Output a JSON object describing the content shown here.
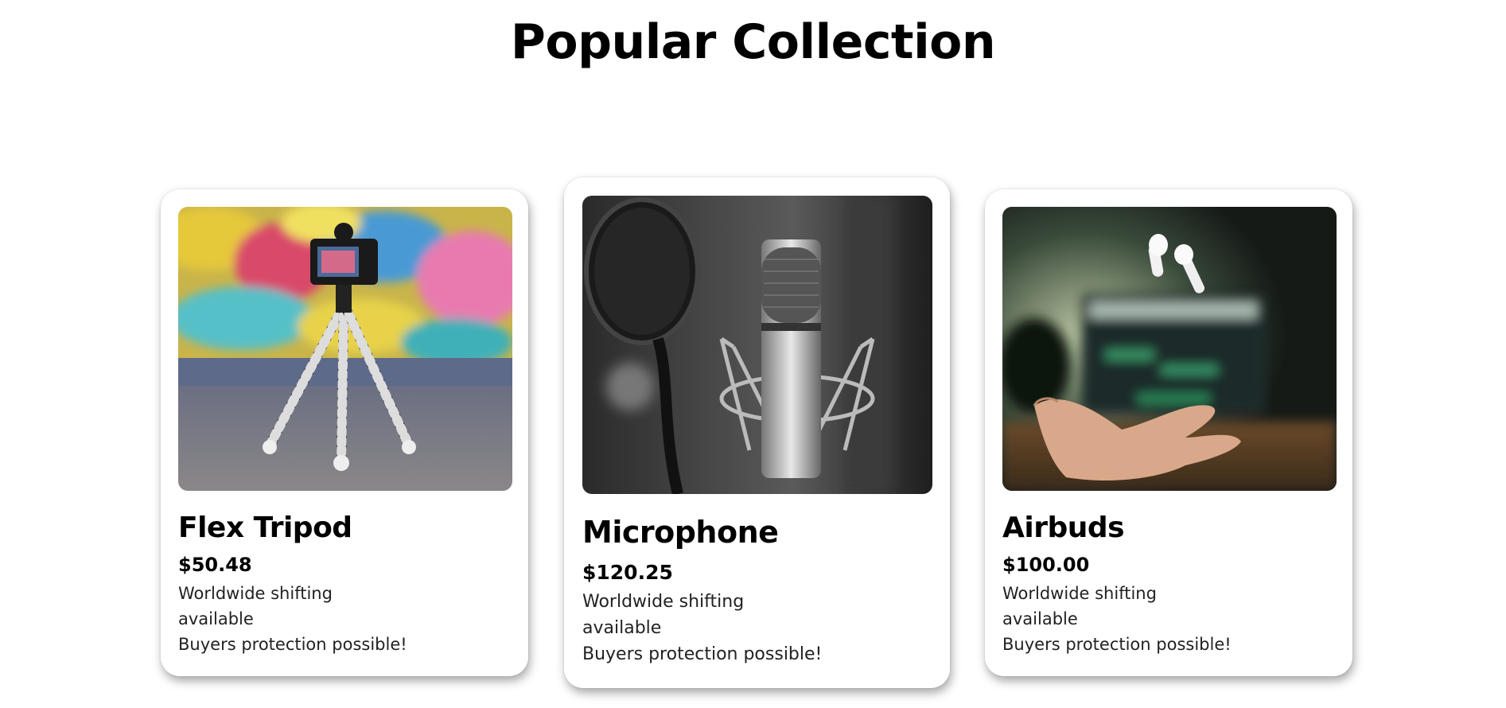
{
  "section": {
    "title": "Popular Collection"
  },
  "products": [
    {
      "image_icon": "tripod-camera-photo",
      "name": "Flex Tripod",
      "price": "$50.48",
      "line1": "Worldwide shifting",
      "line2": "available",
      "line3": "Buyers protection possible!"
    },
    {
      "image_icon": "microphone-photo",
      "name": "Microphone",
      "price": "$120.25",
      "line1": "Worldwide shifting",
      "line2": "available",
      "line3": "Buyers protection possible!"
    },
    {
      "image_icon": "airbuds-photo",
      "name": "Airbuds",
      "price": "$100.00",
      "line1": "Worldwide shifting",
      "line2": "available",
      "line3": "Buyers protection possible!"
    }
  ],
  "colors": {
    "background": "#ffffff",
    "text": "#000000",
    "card": "#ffffff"
  }
}
